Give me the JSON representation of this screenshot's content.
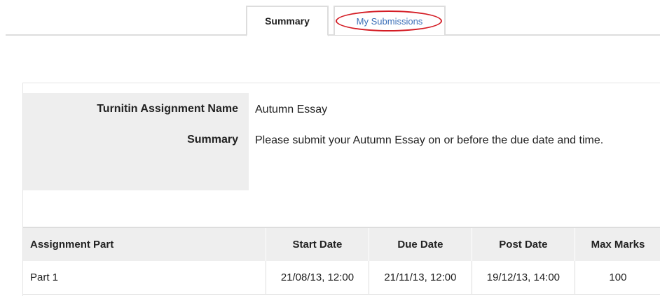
{
  "tabs": [
    {
      "label": "Summary",
      "active": true
    },
    {
      "label": "My Submissions",
      "active": false
    }
  ],
  "highlight_color": "#d41c24",
  "link_color": "#3b6fb8",
  "assignment": {
    "name_label": "Turnitin Assignment Name",
    "name_value": "Autumn Essay",
    "summary_label": "Summary",
    "summary_value": "Please submit your Autumn Essay on or before the due date and time."
  },
  "parts_table": {
    "headers": [
      "Assignment Part",
      "Start Date",
      "Due Date",
      "Post Date",
      "Max Marks"
    ],
    "rows": [
      [
        "Part 1",
        "21/08/13, 12:00",
        "21/11/13, 12:00",
        "19/12/13, 14:00",
        "100"
      ]
    ]
  }
}
